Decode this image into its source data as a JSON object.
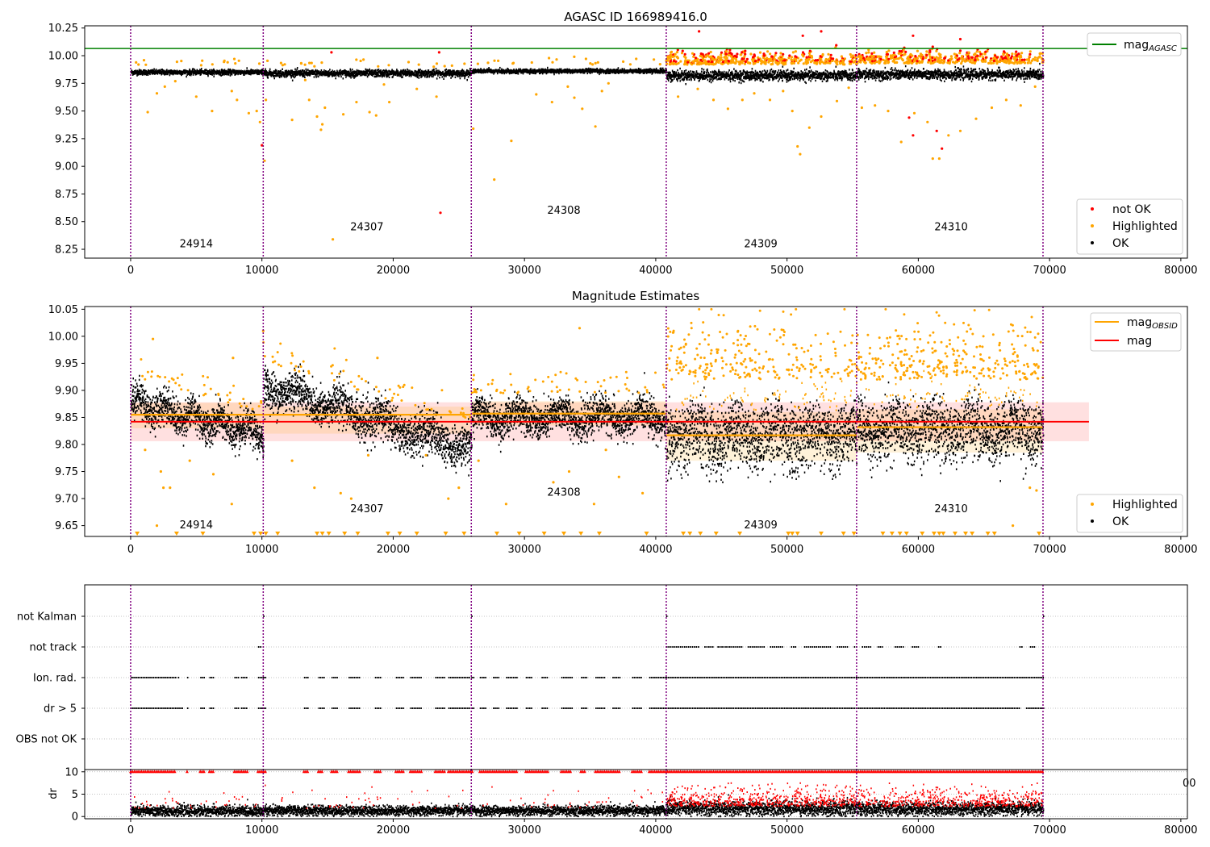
{
  "chart_data": [
    {
      "type": "scatter",
      "title": "AGASC ID 166989416.0",
      "xlim": [
        -3500,
        80500
      ],
      "ylim": [
        8.17,
        10.27
      ],
      "xticks": [
        0,
        10000,
        20000,
        30000,
        40000,
        50000,
        60000,
        70000,
        80000
      ],
      "yticks": [
        "8.25",
        "8.50",
        "8.75",
        "9.00",
        "9.25",
        "9.50",
        "9.75",
        "10.00",
        "10.25"
      ],
      "vlines": [
        0,
        10100,
        25950,
        40800,
        55300,
        69500
      ],
      "hline": {
        "y": 10.065,
        "color": "#008000"
      },
      "obsid_labels": [
        {
          "text": "24914",
          "x": 5000,
          "y": 8.27
        },
        {
          "text": "24307",
          "x": 18000,
          "y": 8.42
        },
        {
          "text": "24308",
          "x": 33000,
          "y": 8.57
        },
        {
          "text": "24309",
          "x": 48000,
          "y": 8.27
        },
        {
          "text": "24310",
          "x": 62500,
          "y": 8.42
        }
      ],
      "series": [
        {
          "name": "not OK",
          "color": "#ff0000"
        },
        {
          "name": "Highlighted",
          "color": "#ffa500"
        },
        {
          "name": "OK",
          "color": "#000000"
        }
      ],
      "line_legend": {
        "name": "mag",
        "sub": "AGASC",
        "color": "#008000"
      },
      "segment_levels": [
        {
          "x0": 0,
          "x1": 10100,
          "mean": 9.85,
          "spread": 0.025
        },
        {
          "x0": 10100,
          "x1": 25950,
          "mean": 9.84,
          "spread": 0.035
        },
        {
          "x0": 25950,
          "x1": 40800,
          "mean": 9.86,
          "spread": 0.02
        },
        {
          "x0": 40800,
          "x1": 55300,
          "mean": 9.82,
          "spread": 0.05
        },
        {
          "x0": 55300,
          "x1": 69500,
          "mean": 9.83,
          "spread": 0.05
        }
      ],
      "outliers_highlighted": [
        [
          600,
          9.92
        ],
        [
          1300,
          9.49
        ],
        [
          2000,
          9.66
        ],
        [
          2600,
          9.72
        ],
        [
          3400,
          9.77
        ],
        [
          5000,
          9.63
        ],
        [
          6200,
          9.5
        ],
        [
          7700,
          9.68
        ],
        [
          7900,
          9.97
        ],
        [
          8100,
          9.6
        ],
        [
          9000,
          9.48
        ],
        [
          9600,
          9.5
        ],
        [
          9850,
          9.4
        ],
        [
          10200,
          9.05
        ],
        [
          10300,
          9.6
        ],
        [
          12300,
          9.42
        ],
        [
          13300,
          9.78
        ],
        [
          13600,
          9.6
        ],
        [
          14200,
          9.45
        ],
        [
          14600,
          9.38
        ],
        [
          14800,
          9.53
        ],
        [
          16200,
          9.47
        ],
        [
          17200,
          9.58
        ],
        [
          18200,
          9.49
        ],
        [
          18700,
          9.46
        ],
        [
          19300,
          9.74
        ],
        [
          19700,
          9.58
        ],
        [
          21800,
          9.7
        ],
        [
          23300,
          9.63
        ],
        [
          15400,
          8.34
        ],
        [
          14500,
          9.33
        ],
        [
          26100,
          9.34
        ],
        [
          27700,
          8.88
        ],
        [
          29000,
          9.23
        ],
        [
          30900,
          9.65
        ],
        [
          32100,
          9.58
        ],
        [
          33300,
          9.72
        ],
        [
          33800,
          9.62
        ],
        [
          34400,
          9.52
        ],
        [
          35400,
          9.36
        ],
        [
          35900,
          9.68
        ],
        [
          36400,
          9.75
        ],
        [
          41700,
          9.63
        ],
        [
          43200,
          9.7
        ],
        [
          44400,
          9.6
        ],
        [
          45500,
          9.52
        ],
        [
          46600,
          9.6
        ],
        [
          47500,
          9.66
        ],
        [
          48700,
          9.6
        ],
        [
          49700,
          9.68
        ],
        [
          50400,
          9.5
        ],
        [
          51000,
          9.11
        ],
        [
          50800,
          9.18
        ],
        [
          51700,
          9.35
        ],
        [
          52600,
          9.45
        ],
        [
          53800,
          9.59
        ],
        [
          54700,
          9.71
        ],
        [
          55700,
          9.53
        ],
        [
          56700,
          9.55
        ],
        [
          57700,
          9.5
        ],
        [
          58700,
          9.22
        ],
        [
          59700,
          9.48
        ],
        [
          60700,
          9.4
        ],
        [
          61100,
          9.07
        ],
        [
          61600,
          9.07
        ],
        [
          62300,
          9.28
        ],
        [
          63200,
          9.32
        ],
        [
          64400,
          9.43
        ],
        [
          65600,
          9.53
        ],
        [
          66700,
          9.6
        ],
        [
          67800,
          9.55
        ],
        [
          68900,
          9.72
        ]
      ],
      "outliers_notok": [
        [
          10000,
          9.19
        ],
        [
          15300,
          10.03
        ],
        [
          23600,
          8.58
        ],
        [
          23500,
          10.03
        ],
        [
          43300,
          10.22
        ],
        [
          51200,
          10.18
        ],
        [
          52600,
          10.22
        ],
        [
          59300,
          9.44
        ],
        [
          59600,
          9.28
        ],
        [
          59600,
          10.18
        ],
        [
          61800,
          9.16
        ],
        [
          63200,
          10.15
        ],
        [
          61400,
          9.32
        ]
      ]
    },
    {
      "type": "scatter",
      "title": "Magnitude Estimates",
      "xlim": [
        -3500,
        80500
      ],
      "ylim": [
        9.63,
        10.055
      ],
      "xticks": [
        0,
        10000,
        20000,
        30000,
        40000,
        50000,
        60000,
        70000,
        80000
      ],
      "yticks": [
        "9.65",
        "9.70",
        "9.75",
        "9.80",
        "9.85",
        "9.90",
        "9.95",
        "10.00",
        "10.05"
      ],
      "vlines": [
        0,
        10100,
        25950,
        40800,
        55300,
        69500
      ],
      "mag_line": {
        "y": 9.842,
        "band": [
          9.806,
          9.878
        ],
        "x1": 73000,
        "color": "#ff0000"
      },
      "obsid_levels": [
        {
          "x0": 0,
          "x1": 10100,
          "mag": 9.855,
          "band": [
            9.83,
            9.877
          ]
        },
        {
          "x0": 10100,
          "x1": 25950,
          "mag": 9.855,
          "band": [
            9.82,
            9.87
          ]
        },
        {
          "x0": 25950,
          "x1": 40800,
          "mag": 9.857,
          "band": [
            9.835,
            9.88
          ]
        },
        {
          "x0": 40800,
          "x1": 55300,
          "mag": 9.817,
          "band": [
            9.77,
            9.86
          ]
        },
        {
          "x0": 55300,
          "x1": 69500,
          "mag": 9.832,
          "band": [
            9.785,
            9.865
          ]
        }
      ],
      "obsid_labels": [
        {
          "text": "24914",
          "x": 5000,
          "y": 9.645
        },
        {
          "text": "24307",
          "x": 18000,
          "y": 9.675
        },
        {
          "text": "24308",
          "x": 33000,
          "y": 9.705
        },
        {
          "text": "24309",
          "x": 48000,
          "y": 9.645
        },
        {
          "text": "24310",
          "x": 62500,
          "y": 9.675
        }
      ],
      "segments": [
        {
          "x0": 0,
          "x1": 10100,
          "start": 9.88,
          "end": 9.815,
          "spread": 0.03,
          "hi_frac": 0.0
        },
        {
          "x0": 10100,
          "x1": 25950,
          "start": 9.91,
          "end": 9.79,
          "spread": 0.035,
          "hi_frac": 0.0
        },
        {
          "x0": 25950,
          "x1": 40800,
          "start": 9.85,
          "end": 9.85,
          "spread": 0.03,
          "hi_frac": 0.0
        },
        {
          "x0": 40800,
          "x1": 55300,
          "start": 9.82,
          "end": 9.82,
          "spread": 0.06,
          "hi_frac": 0.25
        },
        {
          "x0": 55300,
          "x1": 69500,
          "start": 9.83,
          "end": 9.83,
          "spread": 0.055,
          "hi_frac": 0.3
        }
      ],
      "series": [
        {
          "name": "Highlighted",
          "color": "#ffa500"
        },
        {
          "name": "OK",
          "color": "#000000"
        }
      ],
      "line_legend": [
        {
          "name": "mag",
          "sub": "OBSID",
          "color": "#ffa500"
        },
        {
          "name": "mag",
          "sub": "",
          "color": "#ff0000"
        }
      ],
      "outliers_highlighted": [
        [
          1100,
          9.79
        ],
        [
          1700,
          9.995
        ],
        [
          2300,
          9.75
        ],
        [
          2500,
          9.72
        ],
        [
          3000,
          9.72
        ],
        [
          4500,
          9.77
        ],
        [
          6300,
          9.745
        ],
        [
          7700,
          9.69
        ],
        [
          7800,
          9.96
        ],
        [
          2000,
          9.65
        ],
        [
          10100,
          10.01
        ],
        [
          12300,
          9.77
        ],
        [
          14000,
          9.72
        ],
        [
          16000,
          9.71
        ],
        [
          16800,
          9.7
        ],
        [
          18100,
          9.78
        ],
        [
          18800,
          9.96
        ],
        [
          22500,
          9.78
        ],
        [
          24200,
          9.7
        ],
        [
          25000,
          9.72
        ],
        [
          26500,
          9.77
        ],
        [
          28600,
          9.69
        ],
        [
          32200,
          9.73
        ],
        [
          33400,
          9.75
        ],
        [
          34200,
          10.015
        ],
        [
          35300,
          9.69
        ],
        [
          36200,
          9.79
        ],
        [
          37200,
          9.74
        ],
        [
          39000,
          9.71
        ],
        [
          69000,
          9.715
        ],
        [
          68500,
          9.72
        ],
        [
          67200,
          9.65
        ]
      ],
      "bottom_markers": [
        500,
        3500,
        5500,
        9400,
        9900,
        10300,
        11200,
        14200,
        14600,
        15100,
        16300,
        17300,
        19600,
        20500,
        21800,
        24000,
        25400,
        27900,
        29600,
        31500,
        33000,
        34300,
        35700,
        39300,
        42100,
        42600,
        43400,
        44600,
        46400,
        50100,
        50400,
        50800,
        52600,
        54300,
        55100,
        57300,
        58000,
        58600,
        59100,
        60300,
        61200,
        61600,
        61900,
        62800,
        63600,
        64100,
        65300,
        65800,
        69200
      ]
    },
    {
      "type": "scatter",
      "title": "",
      "xlim": [
        -3500,
        80500
      ],
      "xticks": [
        0,
        10000,
        20000,
        30000,
        40000,
        50000,
        60000,
        70000,
        80000
      ],
      "categories": [
        "OBS not OK",
        "dr > 5",
        "Ion. rad.",
        "not track",
        "not Kalman"
      ],
      "vlines": [
        0,
        10100,
        25950,
        40800,
        55300,
        69500
      ],
      "flags": {
        "dr_gt_5": [
          [
            0,
            4000
          ],
          [
            4300,
            4400
          ],
          [
            5300,
            5600
          ],
          [
            6000,
            6300
          ],
          [
            7900,
            8200
          ],
          [
            8400,
            8900
          ],
          [
            9700,
            10100
          ],
          [
            10100,
            10300
          ],
          [
            13200,
            13500
          ],
          [
            14300,
            14700
          ],
          [
            15300,
            15800
          ],
          [
            16600,
            17500
          ],
          [
            18600,
            19100
          ],
          [
            20200,
            20800
          ],
          [
            21300,
            22200
          ],
          [
            23200,
            23900
          ],
          [
            24200,
            25800
          ],
          [
            25950,
            26100
          ],
          [
            26600,
            27100
          ],
          [
            27600,
            28100
          ],
          [
            28600,
            29500
          ],
          [
            30100,
            30600
          ],
          [
            31300,
            31800
          ],
          [
            32800,
            33600
          ],
          [
            34300,
            34700
          ],
          [
            35400,
            36100
          ],
          [
            36700,
            37300
          ],
          [
            38200,
            38900
          ],
          [
            39500,
            40800
          ],
          [
            40800,
            55300
          ],
          [
            55300,
            67700
          ],
          [
            68200,
            69500
          ]
        ],
        "ion_rad": [
          [
            0,
            3400
          ],
          [
            3600,
            3700
          ],
          [
            4300,
            4400
          ],
          [
            5300,
            5600
          ],
          [
            6000,
            6300
          ],
          [
            7900,
            8200
          ],
          [
            8400,
            8900
          ],
          [
            9700,
            10100
          ],
          [
            10100,
            10300
          ],
          [
            13200,
            13500
          ],
          [
            14300,
            14700
          ],
          [
            15300,
            15800
          ],
          [
            16600,
            17500
          ],
          [
            18600,
            19100
          ],
          [
            20200,
            20800
          ],
          [
            21300,
            22200
          ],
          [
            23200,
            23900
          ],
          [
            24200,
            25800
          ],
          [
            25950,
            26100
          ],
          [
            26600,
            27100
          ],
          [
            27600,
            28100
          ],
          [
            28600,
            29500
          ],
          [
            30100,
            30600
          ],
          [
            31300,
            31800
          ],
          [
            32800,
            33600
          ],
          [
            34300,
            34700
          ],
          [
            35400,
            36100
          ],
          [
            36700,
            37300
          ],
          [
            38200,
            38900
          ],
          [
            39500,
            40800
          ],
          [
            40800,
            55300
          ],
          [
            55300,
            69500
          ]
        ],
        "not_track": [
          [
            9700,
            9900
          ],
          [
            40800,
            43200
          ],
          [
            43700,
            44300
          ],
          [
            44700,
            46500
          ],
          [
            47000,
            48200
          ],
          [
            48700,
            49600
          ],
          [
            50300,
            50600
          ],
          [
            51300,
            53300
          ],
          [
            53800,
            54600
          ],
          [
            55100,
            55300
          ],
          [
            55700,
            56300
          ],
          [
            56900,
            57200
          ],
          [
            58200,
            58800
          ],
          [
            59500,
            60000
          ],
          [
            61500,
            61700
          ],
          [
            67700,
            67900
          ],
          [
            68500,
            68800
          ]
        ],
        "not_kalman": [
          10100,
          25950,
          40800,
          69500
        ]
      }
    },
    {
      "type": "scatter",
      "title": "",
      "ylabel": "dr",
      "xlim": [
        -3500,
        80500
      ],
      "ylim": [
        -0.5,
        10.5
      ],
      "yticks": [
        "0",
        "5",
        "10"
      ],
      "xticks": [
        0,
        10000,
        20000,
        30000,
        40000,
        50000,
        60000,
        70000,
        80000
      ],
      "xtick_labels": [
        "0",
        "10000",
        "20000",
        "30000",
        "40000",
        "50000",
        "60000",
        "70000",
        "80000"
      ],
      "clipped_label": "00",
      "vlines": [
        0,
        10100,
        25950,
        40800,
        55300,
        69500
      ],
      "segments": [
        {
          "x0": 0,
          "x1": 10100,
          "base": 1.2,
          "spread": 1.2,
          "red_frac": 0.04
        },
        {
          "x0": 10100,
          "x1": 25950,
          "base": 1.3,
          "spread": 1.1,
          "red_frac": 0.03
        },
        {
          "x0": 25950,
          "x1": 40800,
          "base": 1.3,
          "spread": 1.1,
          "red_frac": 0.03
        },
        {
          "x0": 40800,
          "x1": 55300,
          "base": 1.8,
          "spread": 1.6,
          "red_frac": 0.45
        },
        {
          "x0": 55300,
          "x1": 69500,
          "base": 1.7,
          "spread": 1.5,
          "red_frac": 0.4
        }
      ]
    }
  ]
}
